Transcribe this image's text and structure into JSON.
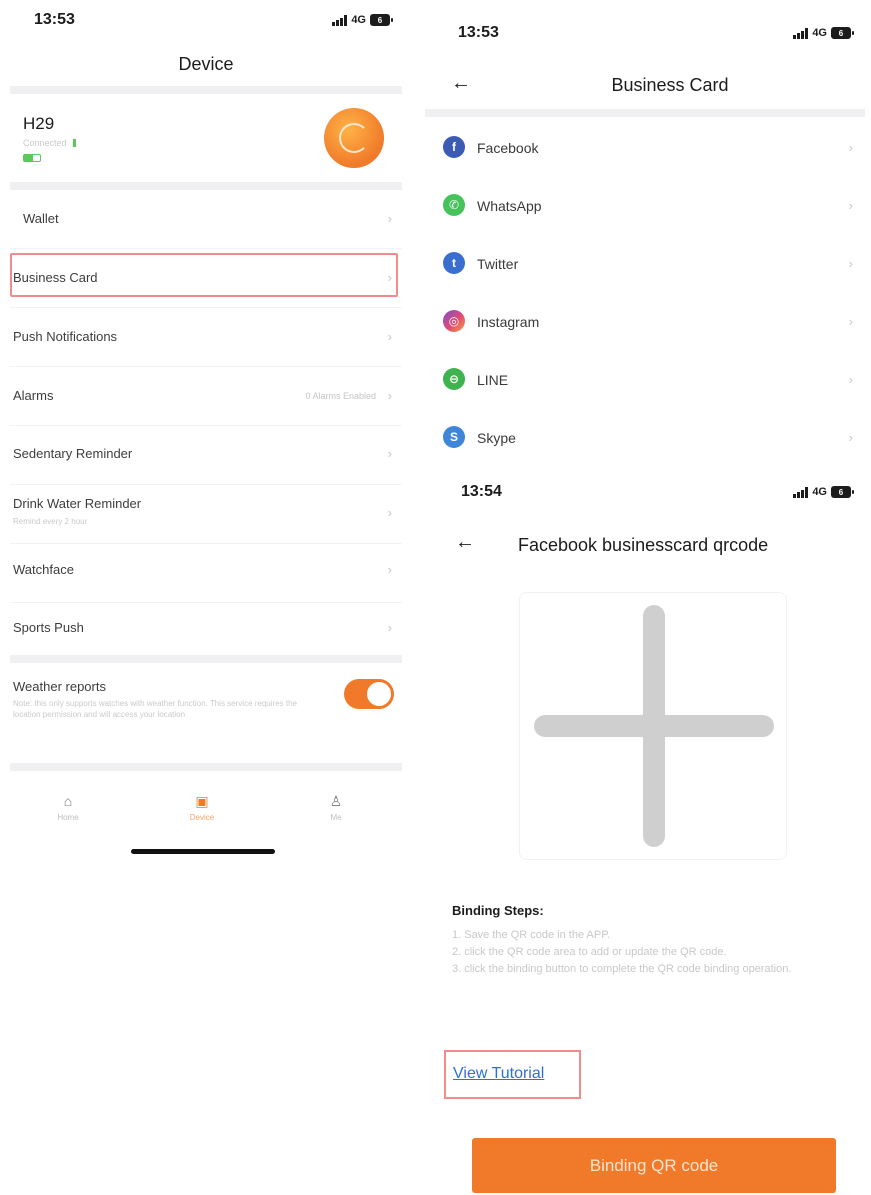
{
  "device_screen": {
    "status": {
      "time": "13:53",
      "network": "4G",
      "battery": "6"
    },
    "title": "Device",
    "device": {
      "name": "H29",
      "status": "Connected"
    },
    "menu": [
      {
        "label": "Wallet"
      },
      {
        "label": "Business Card"
      },
      {
        "label": "Push Notifications"
      },
      {
        "label": "Alarms",
        "value": "0 Alarms Enabled"
      },
      {
        "label": "Sedentary Reminder"
      },
      {
        "label": "Drink Water Reminder",
        "sub": "Remind every 2 hour"
      },
      {
        "label": "Watchface"
      },
      {
        "label": "Sports Push"
      }
    ],
    "weather": {
      "label": "Weather reports",
      "description": "Note: this only supports watches with weather function. This service requires the location permission and will access your location",
      "enabled": true
    },
    "tabbar": [
      {
        "label": "Home",
        "icon": "home-icon"
      },
      {
        "label": "Device",
        "icon": "watch-icon",
        "active": true
      },
      {
        "label": "Me",
        "icon": "person-icon"
      }
    ],
    "accent": "#f07a2a",
    "highlight": "#f28b8b"
  },
  "business_card_screen": {
    "status": {
      "time": "13:53",
      "network": "4G",
      "battery": "6"
    },
    "title": "Business Card",
    "items": [
      {
        "label": "Facebook",
        "icon": "facebook-icon",
        "color": "#3b5bb5",
        "glyph": "f"
      },
      {
        "label": "WhatsApp",
        "icon": "whatsapp-icon",
        "color": "#45c35a",
        "glyph": "✆"
      },
      {
        "label": "Twitter",
        "icon": "twitter-icon",
        "color": "#3a6fd0",
        "glyph": "t"
      },
      {
        "label": "Instagram",
        "icon": "instagram-icon",
        "color": "#d9477a",
        "glyph": "◎"
      },
      {
        "label": "LINE",
        "icon": "line-icon",
        "color": "#3fb34f",
        "glyph": "⊖"
      },
      {
        "label": "Skype",
        "icon": "skype-icon",
        "color": "#3f86d8",
        "glyph": "S"
      }
    ]
  },
  "qrcode_screen": {
    "status": {
      "time": "13:54",
      "network": "4G",
      "battery": "6"
    },
    "title": "Facebook businesscard qrcode",
    "steps_title": "Binding Steps:",
    "steps": [
      "1. Save the QR code in the APP.",
      "2. click the QR code area to add or update the QR code.",
      "3. click the binding button to complete the QR code binding operation."
    ],
    "tutorial_link": "View Tutorial",
    "bind_button": "Binding QR code",
    "button_color": "#f07a2a",
    "link_color": "#2f6fd6"
  }
}
